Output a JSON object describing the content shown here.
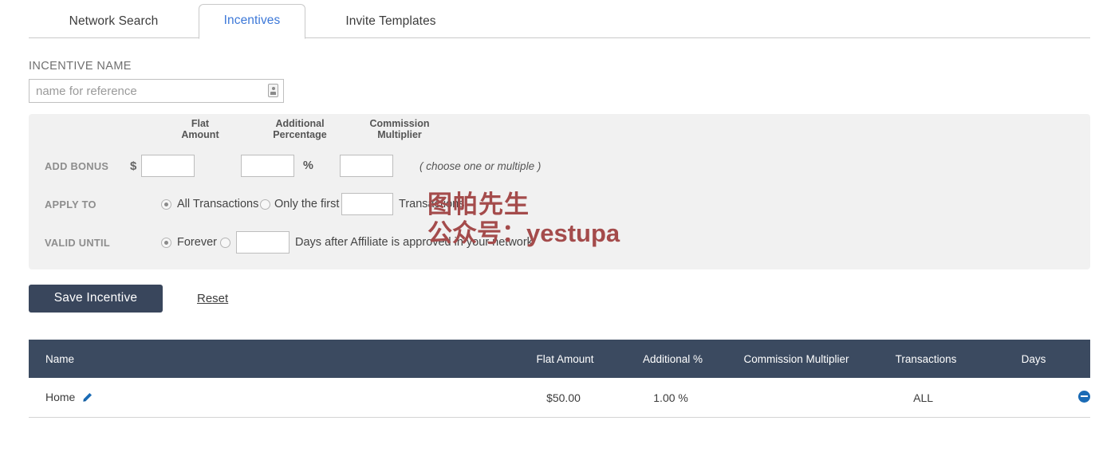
{
  "tabs": [
    {
      "label": "Network Search",
      "active": false
    },
    {
      "label": "Incentives",
      "active": true
    },
    {
      "label": "Invite Templates",
      "active": false
    }
  ],
  "incentive_name": {
    "label": "INCENTIVE NAME",
    "placeholder": "name for reference",
    "value": "",
    "icon": "autofill-icon"
  },
  "panel": {
    "columns": {
      "flat_amount_line1": "Flat",
      "flat_amount_line2": "Amount",
      "additional_line1": "Additional",
      "additional_line2": "Percentage",
      "multiplier_line1": "Commission",
      "multiplier_line2": "Multiplier"
    },
    "add_bonus": {
      "label": "ADD BONUS",
      "currency_symbol": "$",
      "flat_amount_value": "",
      "percent_value": "",
      "percent_symbol": "%",
      "multiplier_value": "",
      "hint": "( choose one or multiple )"
    },
    "apply_to": {
      "label": "APPLY TO",
      "option_all": "All Transactions",
      "option_first": "Only the first",
      "first_count_value": "",
      "suffix": "Transactions",
      "selected": "all"
    },
    "valid_until": {
      "label": "VALID UNTIL",
      "option_forever": "Forever",
      "days_value": "",
      "suffix": "Days after Affiliate is approved in your network",
      "selected": "forever"
    }
  },
  "actions": {
    "save_label": "Save Incentive",
    "reset_label": "Reset"
  },
  "table": {
    "headers": {
      "name": "Name",
      "flat_amount": "Flat Amount",
      "additional": "Additional %",
      "multiplier": "Commission Multiplier",
      "transactions": "Transactions",
      "days": "Days",
      "actions": ""
    },
    "rows": [
      {
        "name": "Home",
        "flat_amount": "$50.00",
        "additional": "1.00 %",
        "multiplier": "",
        "transactions": "ALL",
        "days": "",
        "edit_icon": "pencil-icon",
        "remove_icon": "minus-circle-icon"
      }
    ]
  },
  "watermark": {
    "line1": "图帕先生",
    "line2": "公众号：yestupa",
    "color": "#a44b4b"
  },
  "colors": {
    "accent_blue": "#3c78d8",
    "dark_navy": "#39465c",
    "table_header": "#3b4a60",
    "panel_bg": "#f1f1f1",
    "link_blue": "#1a6bb5"
  }
}
